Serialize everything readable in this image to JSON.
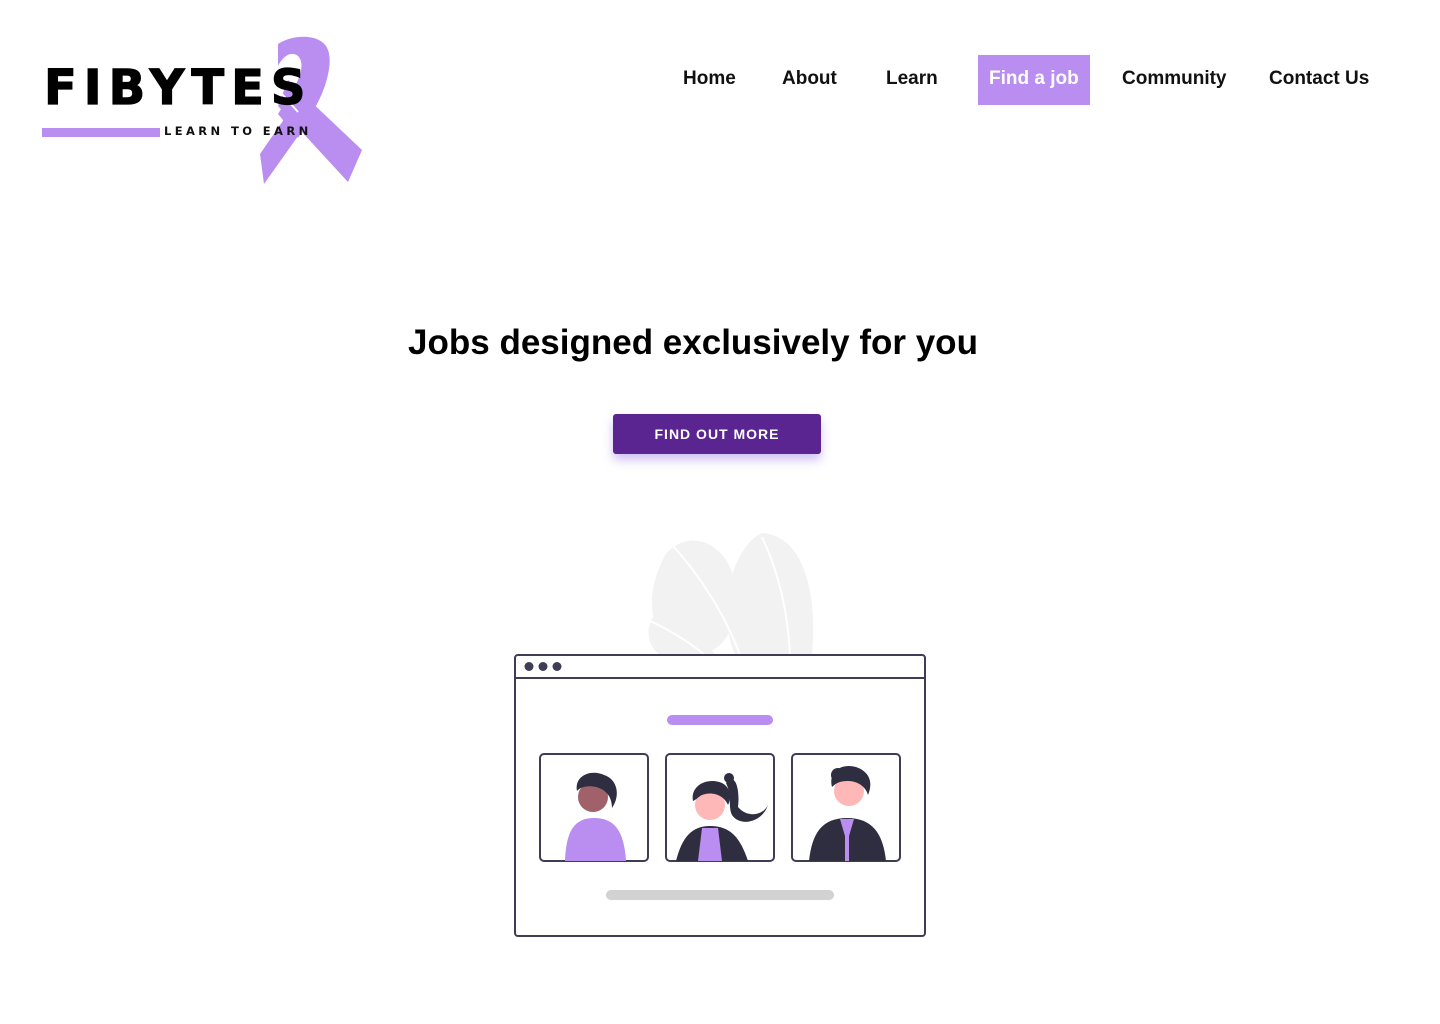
{
  "brand": {
    "name": "FIBYTES",
    "tagline": "LEARN TO EARN",
    "accent_color": "#b98ef0",
    "primary_color": "#5a2590"
  },
  "nav": {
    "items": [
      {
        "label": "Home",
        "active": false
      },
      {
        "label": "About",
        "active": false
      },
      {
        "label": "Learn",
        "active": false
      },
      {
        "label": "Find a job",
        "active": true
      },
      {
        "label": "Community",
        "active": false
      },
      {
        "label": "Contact Us",
        "active": false
      }
    ]
  },
  "hero": {
    "title": "Jobs designed exclusively for you",
    "cta_label": "FIND OUT MORE"
  },
  "illustration": {
    "icon": "browser-window-team-icon",
    "profile_cards": [
      "person-short-hair-icon",
      "person-ponytail-icon",
      "person-suit-icon"
    ]
  }
}
